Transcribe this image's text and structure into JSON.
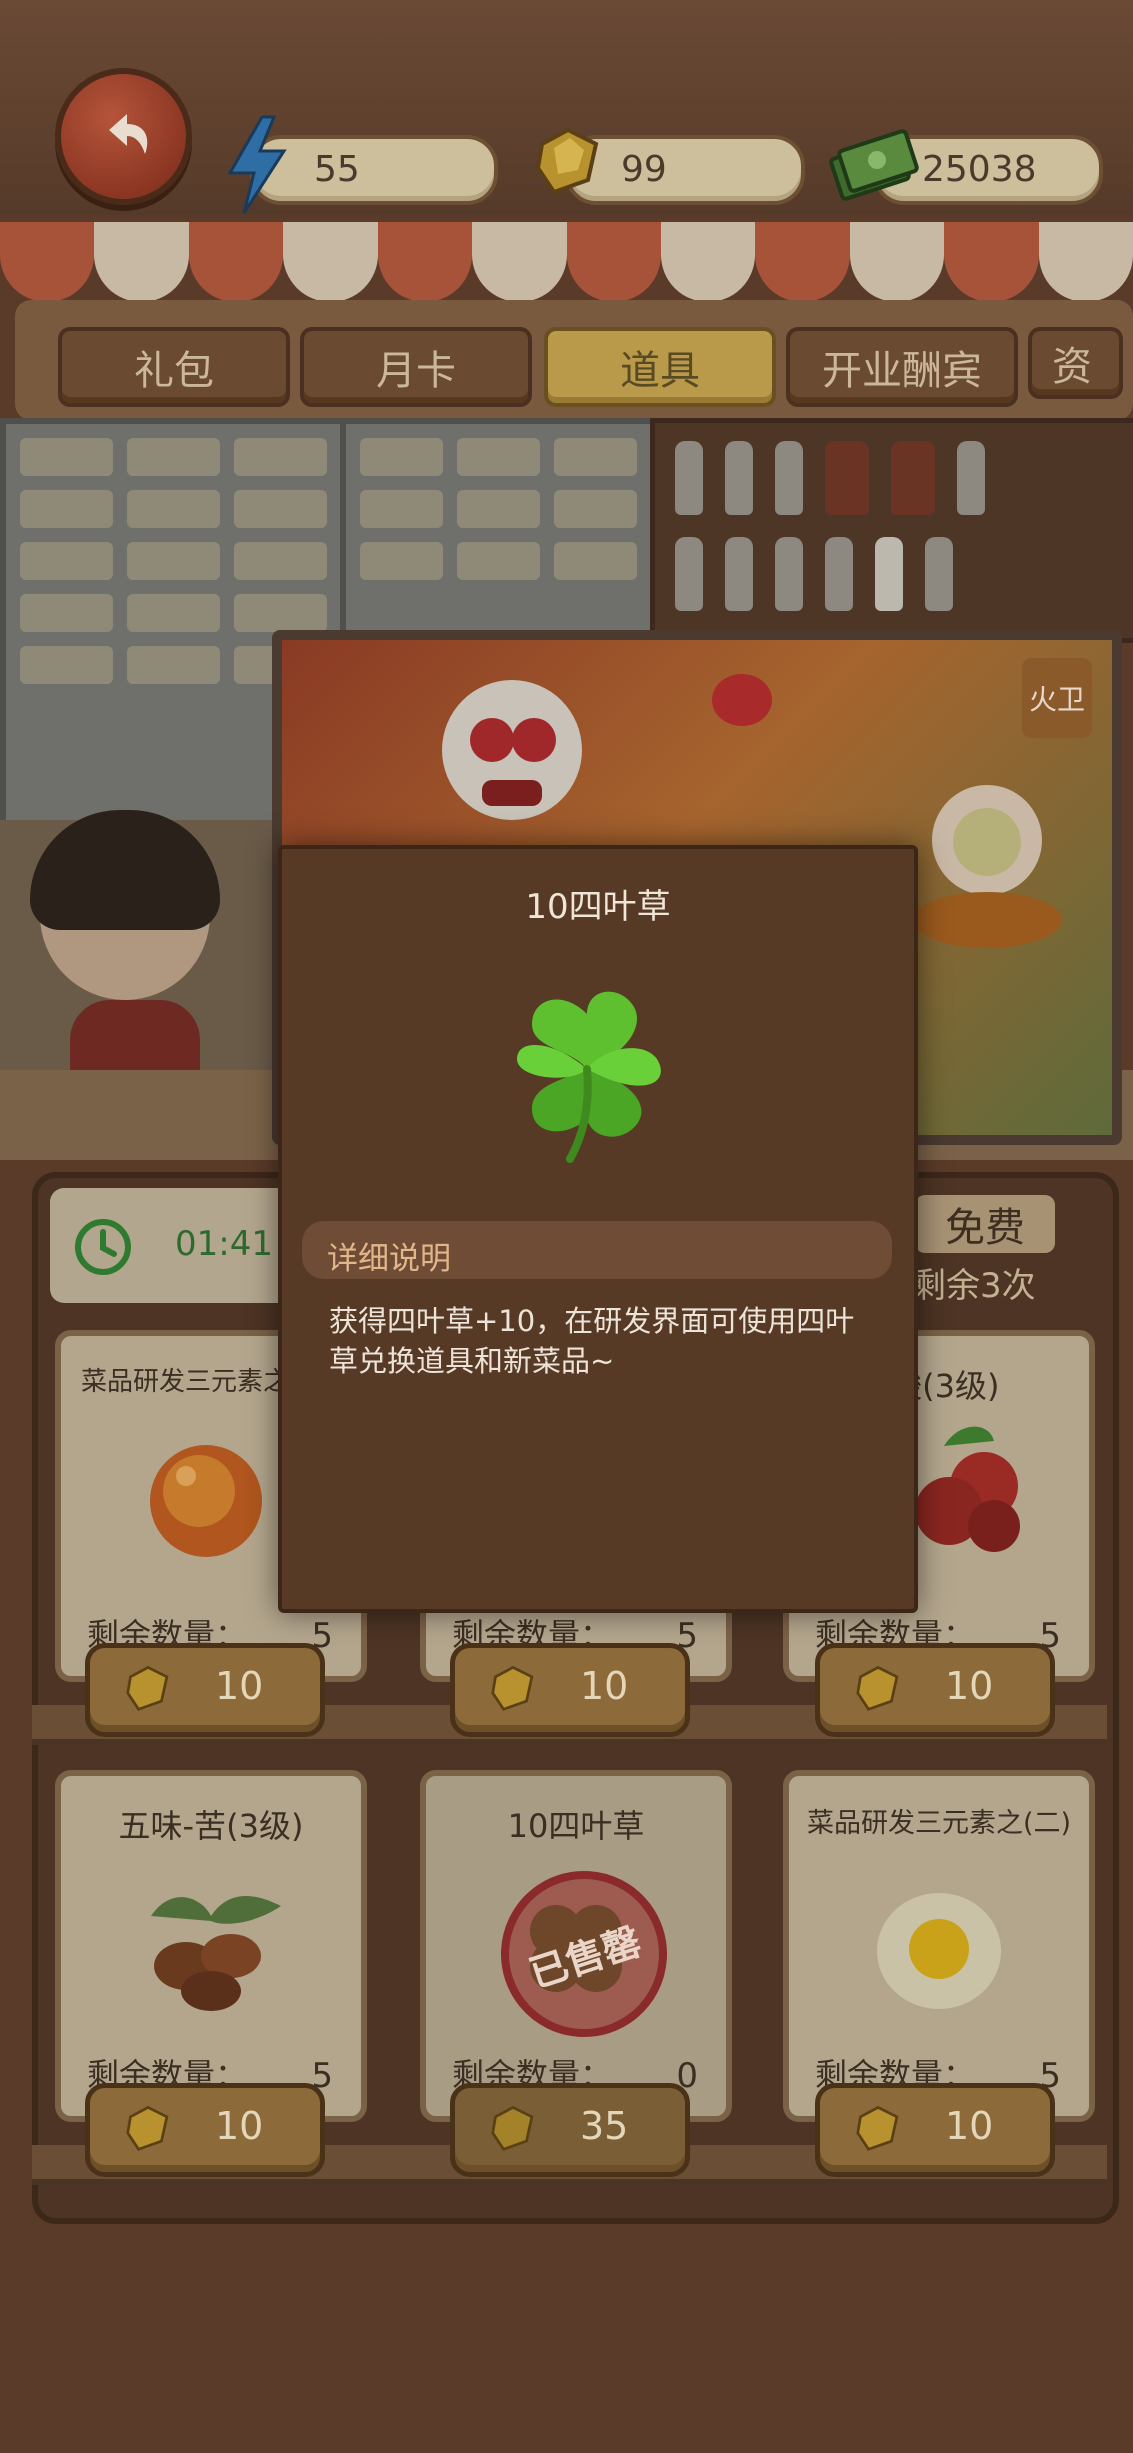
{
  "resources": {
    "energy": "55",
    "gems": "99",
    "cash": "25038"
  },
  "tabs": [
    {
      "label": "礼包"
    },
    {
      "label": "月卡"
    },
    {
      "label": "道具"
    },
    {
      "label": "开业酬宾"
    },
    {
      "label": "资"
    }
  ],
  "active_tab": "道具",
  "timer": "01:41",
  "free": {
    "label": "免费",
    "remaining": "剩余3次"
  },
  "modal": {
    "title": "10四叶草",
    "desc_heading": "详细说明",
    "description": "获得四叶草+10，在研发界面可使用四叶草兑换道具和新菜品~"
  },
  "items": [
    {
      "title": "菜品研发三元素之",
      "qty_label": "剩余数量：",
      "qty": "5",
      "price": "10"
    },
    {
      "title": "",
      "qty_label": "剩余数量：",
      "qty": "5",
      "price": "10"
    },
    {
      "title": "-酸(3级)",
      "qty_label": "剩余数量：",
      "qty": "5",
      "price": "10"
    },
    {
      "title": "五味-苦(3级)",
      "qty_label": "剩余数量：",
      "qty": "5",
      "price": "10"
    },
    {
      "title": "10四叶草",
      "qty_label": "剩余数量：",
      "qty": "0",
      "price": "35",
      "sold_out_stamp": "已售罄"
    },
    {
      "title": "菜品研发三元素之(二)",
      "qty_label": "剩余数量：",
      "qty": "5",
      "price": "10"
    }
  ],
  "banner_logo": "火卫",
  "colors": {
    "gem": "#c9a23a",
    "clover": "#5ec02e",
    "accent_tab": "#b99a4a"
  }
}
